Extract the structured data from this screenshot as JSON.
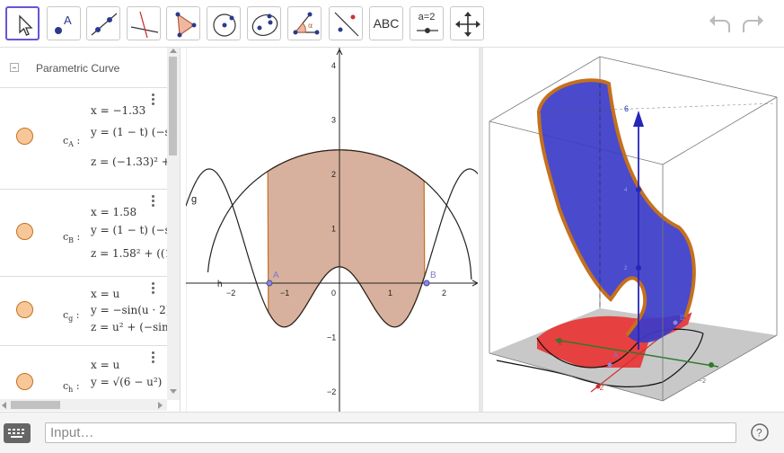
{
  "toolbar": {
    "text_tool_label": "ABC",
    "slider_tool_label": "a=2",
    "undo": "undo-icon",
    "redo": "redo-icon"
  },
  "algebra": {
    "header": "Parametric Curve",
    "rows": [
      {
        "name": "c",
        "sub": "A",
        "lines": [
          "x = −1.33",
          "y = (1 − t) (−s",
          "z = (−1.33)² +"
        ]
      },
      {
        "name": "c",
        "sub": "B",
        "lines": [
          "x = 1.58",
          "y = (1 − t) (−s",
          "z = 1.58² + ((1"
        ]
      },
      {
        "name": "c",
        "sub": "g",
        "lines": [
          "x = u",
          "y = −sin(u · 2)",
          "z = u² + (−sin"
        ]
      },
      {
        "name": "c",
        "sub": "h",
        "lines": [
          "x = u",
          "y = √(6 − u²)",
          ""
        ]
      }
    ]
  },
  "graphics2d": {
    "label_g": "g",
    "label_h": "h",
    "point_a": "A",
    "point_b": "B",
    "x_ticks": [
      "−2",
      "−1",
      "0",
      "1",
      "2"
    ],
    "y_ticks": [
      "4",
      "3",
      "2",
      "1",
      "−1",
      "−2"
    ]
  },
  "graphics3d": {
    "z_axis_label": "6",
    "z_ticks": [
      "4",
      "2"
    ],
    "floor_labels": [
      "2",
      "−2",
      "−2"
    ],
    "points": [
      "A",
      "B"
    ]
  },
  "input": {
    "placeholder": "Input…"
  },
  "colors": {
    "accent": "#6557d2",
    "fill": "#d4a893",
    "curve": "#c5701d",
    "surface": "#3b3bc8",
    "red": "#e53c3c"
  }
}
